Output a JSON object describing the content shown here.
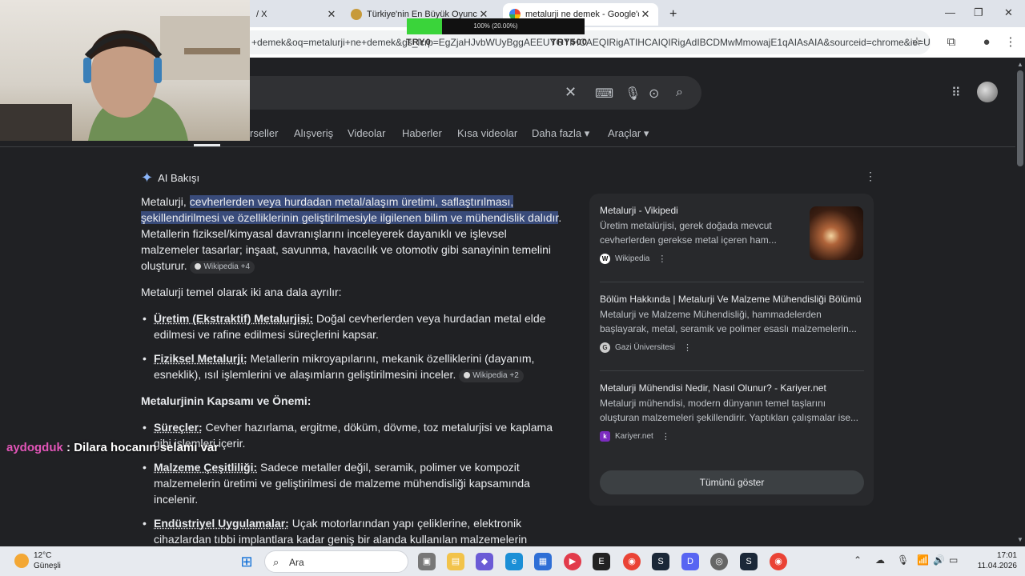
{
  "browser": {
    "tabs": [
      {
        "label": "/ X"
      },
      {
        "label": "Türkiye'nin En Büyük Oyuncu D..."
      },
      {
        "label": "metalurji ne demek - Google'da..."
      }
    ],
    "new_tab_label": "+",
    "url": "+demek&oq=metalurji+ne+demek&gs_lcrp=EgZjaHJvbWUyBggAEEUYOTIHCAEQIRigATIHCAIQIRigAdIBCDMwMmowajE1qAIAsAIA&sourceid=chrome&ie=UTF-8"
  },
  "overlay": {
    "progress_text": "100% (20.00%)",
    "progress_fraction": 0.2,
    "ghost_left": "TRY0",
    "ghost_right": "TRY500"
  },
  "google": {
    "nav_tabs": [
      "rseller",
      "Alışveriş",
      "Videolar",
      "Haberler",
      "Kısa videolar",
      "Daha fazla",
      "Araçlar"
    ],
    "ai": {
      "header": "AI Bakışı",
      "intro_pre": "Metalurji, ",
      "intro_hl": "cevherlerden veya hurdadan metal/alaşım üretimi, saflaştırılması, şekillendirilmesi ve özelliklerinin geliştirilmesiyle ilgilenen bilim ve mühendislik dalıdır",
      "intro_post": ". Metallerin fiziksel/kimyasal davranışlarını inceleyerek dayanıklı ve işlevsel malzemeler tasarlar; inşaat, savunma, havacılık ve otomotiv gibi sanayinin temelini oluşturur.",
      "intro_chip": "Wikipedia +4",
      "branches_intro": "Metalurji temel olarak iki ana dala ayrılır:",
      "branches": [
        {
          "term": "Üretim (Ekstraktif) Metalurjisi:",
          "text": " Doğal cevherlerden veya hurdadan metal elde edilmesi ve rafine edilmesi süreçlerini kapsar.",
          "chip": ""
        },
        {
          "term": "Fiziksel Metalurji:",
          "text": " Metallerin mikroyapılarını, mekanik özelliklerini (dayanım, esneklik), ısıl işlemlerini ve alaşımların geliştirilmesini inceler.",
          "chip": "Wikipedia +2"
        }
      ],
      "scope_heading": "Metalurjinin Kapsamı ve Önemi:",
      "scope": [
        {
          "term": "Süreçler:",
          "text": " Cevher hazırlama, ergitme, döküm, dövme, toz metalurjisi ve kaplama gibi işlemleri içerir."
        },
        {
          "term": "Malzeme Çeşitliliği:",
          "text": " Sadece metaller değil, seramik, polimer ve kompozit malzemelerin üretimi ve geliştirilmesi de malzeme mühendisliği kapsamında incelenir."
        },
        {
          "term": "Endüstriyel Uygulamalar:",
          "text": " Uçak motorlarından yapı çeliklerine, elektronik cihazlardan tıbbi implantlara kadar geniş bir alanda kullanılan malzemelerin"
        }
      ]
    },
    "sources": [
      {
        "title": "Metalurji - Vikipedi",
        "snippet": "Üretim metalürjisi, gerek doğada mevcut cevherlerden gerekse metal içeren ham...",
        "site": "Wikipedia",
        "logo": "W"
      },
      {
        "title": "Bölüm Hakkında | Metalurji Ve Malzeme Mühendisliği Bölümü",
        "snippet": "Metalurji ve Malzeme Mühendisliği, hammadelerden başlayarak, metal, seramik ve polimer esaslı malzemelerin...",
        "site": "Gazi Üniversitesi",
        "logo": "G"
      },
      {
        "title": "Metalurji Mühendisi Nedir, Nasıl Olunur? - Kariyer.net",
        "snippet": "Metalurji mühendisi, modern dünyanın temel taşlarını oluşturan malzemeleri şekillendirir. Yaptıkları çalışmalar ise...",
        "site": "Kariyer.net",
        "logo": "k"
      }
    ],
    "show_all": "Tümünü göster"
  },
  "chat": {
    "user": "aydogduk",
    "separator": " : ",
    "message": "Dilara hocanın selamı var"
  },
  "taskbar": {
    "weather_temp": "12°C",
    "weather_desc": "Güneşli",
    "search_label": "Ara",
    "time": "17:01",
    "date": "11.04.2026"
  },
  "colors": {
    "highlight": "#394b7a",
    "chat_user": "#e255b8",
    "progress": "#3ad43a"
  }
}
